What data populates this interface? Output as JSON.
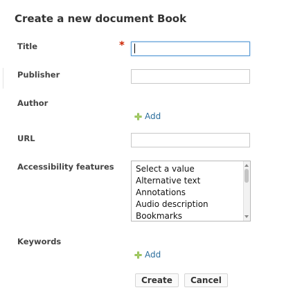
{
  "form": {
    "title": "Create a new document Book",
    "required_marker": "*"
  },
  "fields": {
    "title": {
      "label": "Title",
      "value": ""
    },
    "publisher": {
      "label": "Publisher",
      "value": ""
    },
    "author": {
      "label": "Author",
      "add_label": "Add"
    },
    "url": {
      "label": "URL",
      "value": ""
    },
    "accessibility": {
      "label": "Accessibility features",
      "options": [
        "Select a value",
        "Alternative text",
        "Annotations",
        "Audio description",
        "Bookmarks"
      ]
    },
    "keywords": {
      "label": "Keywords",
      "add_label": "Add"
    }
  },
  "actions": {
    "create_label": "Create",
    "cancel_label": "Cancel"
  },
  "icons": {
    "add": "plus-icon"
  },
  "colors": {
    "link": "#2a6d9c",
    "required": "#cc2200",
    "focus_border": "#5a9bd5",
    "add_icon": "#7aa83b"
  }
}
